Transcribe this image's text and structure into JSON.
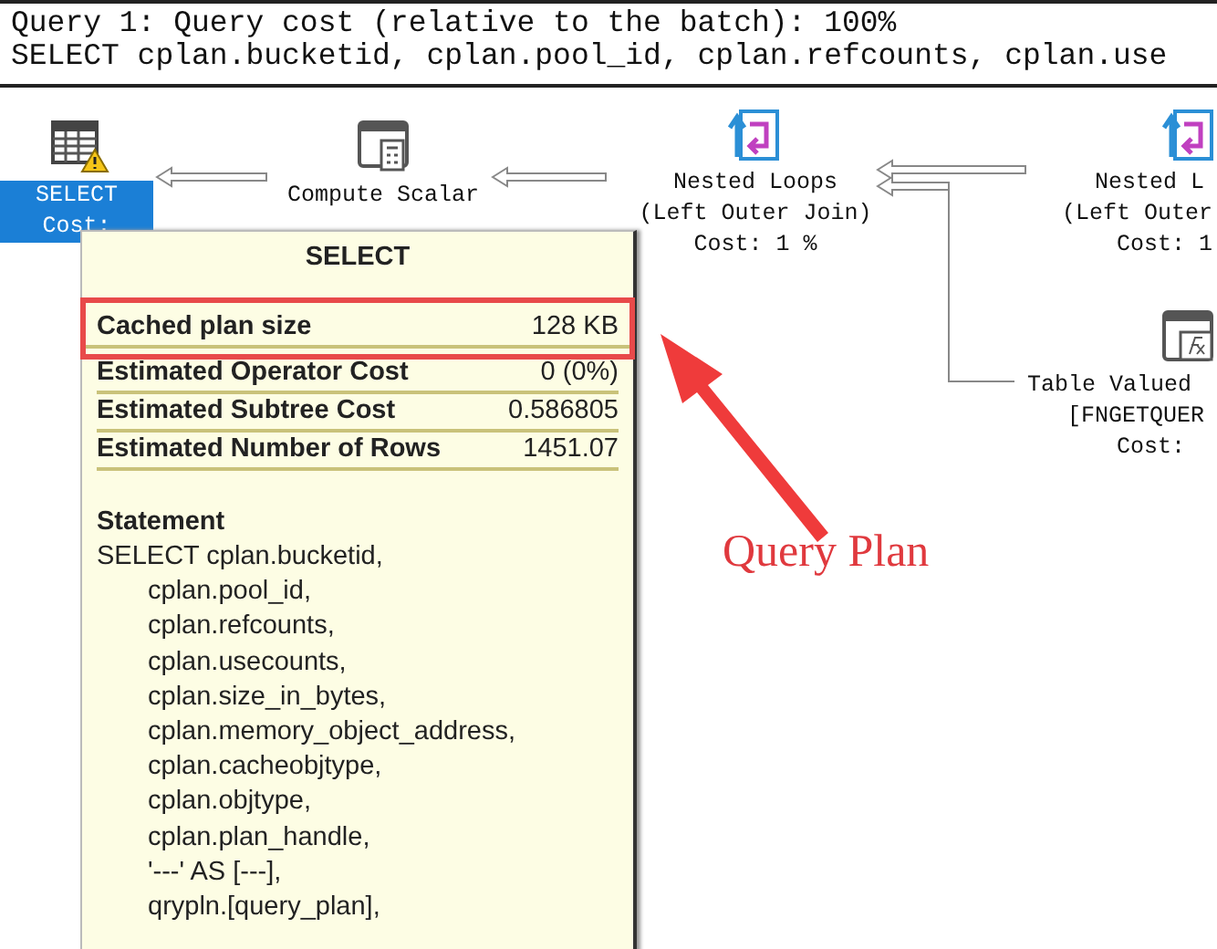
{
  "query_header": {
    "title": "Query 1: Query cost (relative to the batch): 100%",
    "statement": "SELECT cplan.bucketid, cplan.pool_id, cplan.refcounts, cplan.use"
  },
  "plan_nodes": [
    {
      "kind": "select",
      "lines": [
        "SELECT",
        "Cost:"
      ],
      "selected": true,
      "warning": true
    },
    {
      "kind": "compute_scalar",
      "lines": [
        "Compute Scalar"
      ],
      "selected": false
    },
    {
      "kind": "nested_loops",
      "lines": [
        "Nested Loops",
        "(Left Outer Join)",
        "Cost: 1 %"
      ],
      "selected": false
    },
    {
      "kind": "nested_loops",
      "lines": [
        "Nested L",
        "(Left Outer",
        "Cost: 1"
      ],
      "selected": false
    },
    {
      "kind": "table_valued_function",
      "lines": [
        "Table Valued",
        "[FNGETQUER",
        "Cost:"
      ],
      "selected": false
    }
  ],
  "tooltip": {
    "title": "SELECT",
    "properties": [
      {
        "name": "Cached plan size",
        "value": "128 KB",
        "highlighted": true
      },
      {
        "name": "Estimated Operator Cost",
        "value": "0 (0%)",
        "highlighted": false
      },
      {
        "name": "Estimated Subtree Cost",
        "value": "0.586805",
        "highlighted": false
      },
      {
        "name": "Estimated Number of Rows",
        "value": "1451.07",
        "highlighted": false
      }
    ],
    "statement_label": "Statement",
    "statement_lines": [
      "SELECT cplan.bucketid,",
      "cplan.pool_id,",
      "cplan.refcounts,",
      "cplan.usecounts,",
      "cplan.size_in_bytes,",
      "cplan.memory_object_address,",
      "cplan.cacheobjtype,",
      "cplan.objtype,",
      "cplan.plan_handle,",
      "'---' AS [---],",
      "qrypln.[query_plan],"
    ]
  },
  "annotation": {
    "text": "Query Plan"
  }
}
